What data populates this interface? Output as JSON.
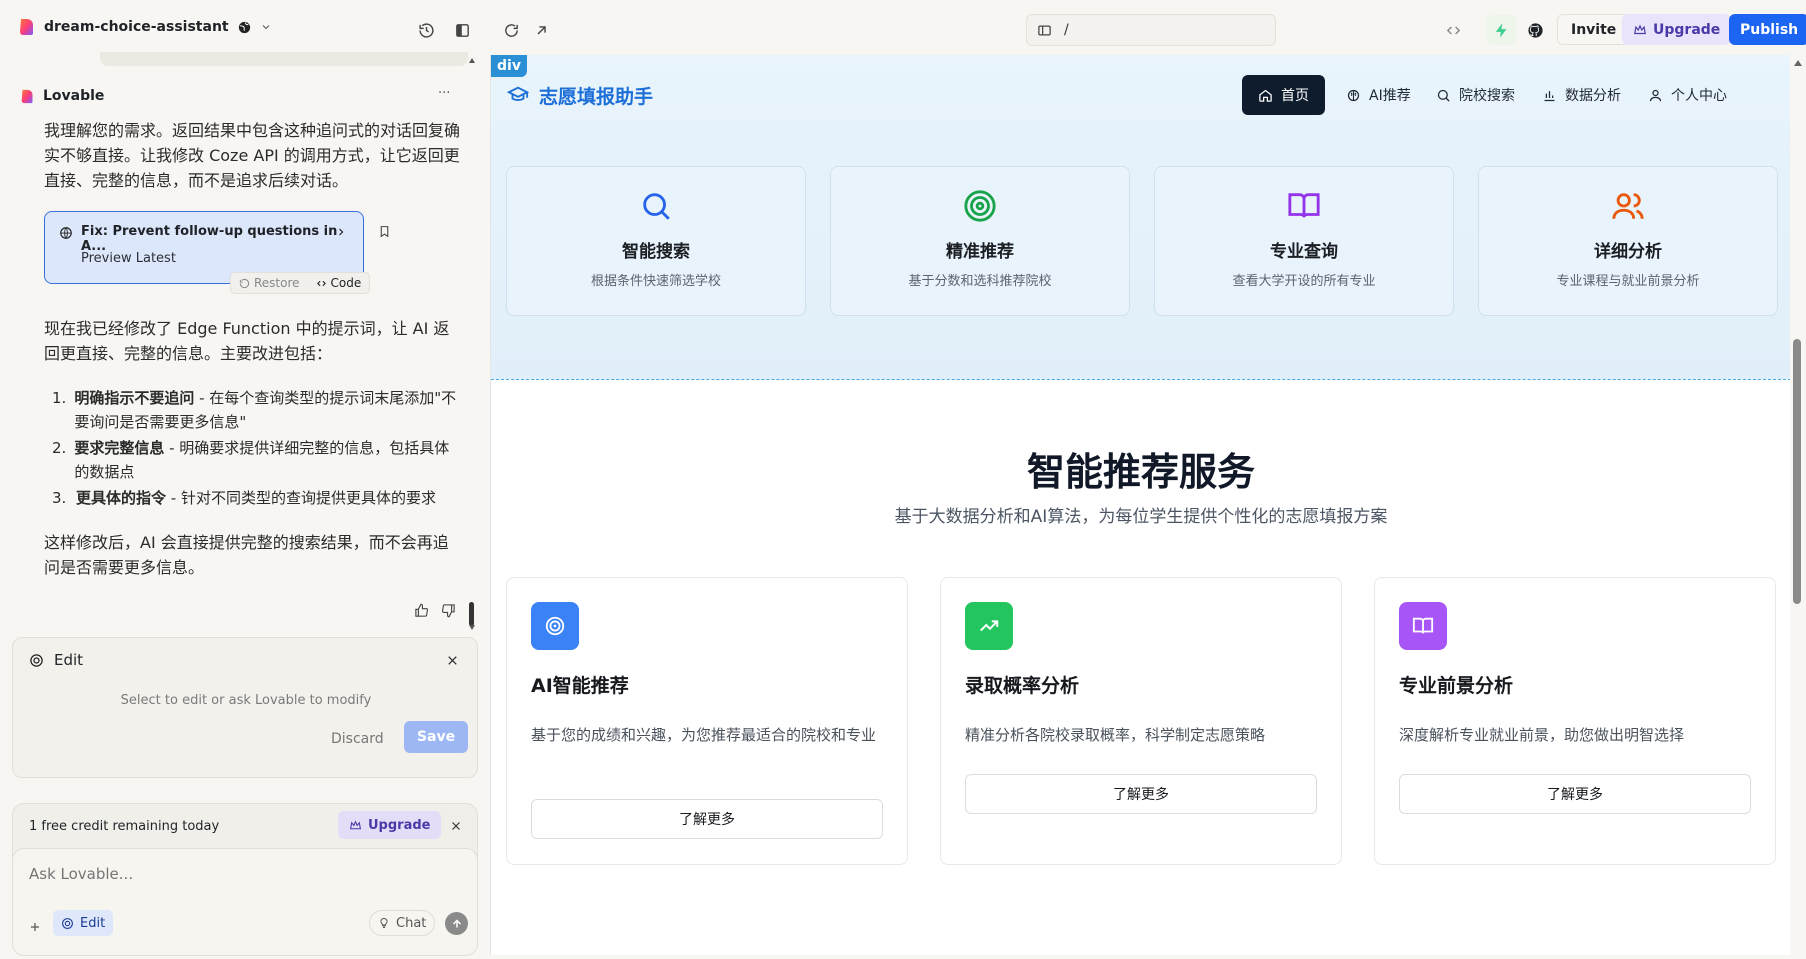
{
  "project": {
    "name": "dream-choice-assistant"
  },
  "topbar": {
    "url_path": "/",
    "invite_label": "Invite",
    "upgrade_label": "Upgrade",
    "publish_label": "Publish"
  },
  "chat": {
    "sender": "Lovable",
    "menu_label": "···",
    "message1": "我理解您的需求。返回结果中包含这种追问式的对话回复确实不够直接。让我修改 Coze API 的调用方式，让它返回更直接、完整的信息，而不是追求后续对话。",
    "commit": {
      "title": "Fix: Prevent follow-up questions in A...",
      "subtitle": "Preview Latest",
      "restore_label": "Restore",
      "code_label": "Code"
    },
    "message2": "现在我已经修改了 Edge Function 中的提示词，让 AI 返回更直接、完整的信息。主要改进包括：",
    "list": [
      {
        "num": "1.",
        "bold": "明确指示不要追问",
        "rest": " - 在每个查询类型的提示词末尾添加\"不要询问是否需要更多信息\""
      },
      {
        "num": "2.",
        "bold": "要求完整信息",
        "rest": " - 明确要求提供详细完整的信息，包括具体的数据点"
      },
      {
        "num": "3.",
        "bold": "更具体的指令",
        "rest": " - 针对不同类型的查询提供更具体的要求"
      }
    ],
    "message3": "这样修改后，AI 会直接提供完整的搜索结果，而不会再追问是否需要更多信息。"
  },
  "edit_panel": {
    "title": "Edit",
    "hint": "Select to edit or ask Lovable to modify",
    "discard_label": "Discard",
    "save_label": "Save"
  },
  "credit": {
    "text": "1 free credit remaining today",
    "upgrade_label": "Upgrade"
  },
  "composer": {
    "placeholder": "Ask Lovable...",
    "edit_label": "Edit",
    "chat_label": "Chat"
  },
  "preview": {
    "badge": "div",
    "brand": "志愿填报助手",
    "nav": [
      {
        "label": "首页",
        "icon": "home-icon"
      },
      {
        "label": "AI推荐",
        "icon": "brain-icon"
      },
      {
        "label": "院校搜索",
        "icon": "search-icon"
      },
      {
        "label": "数据分析",
        "icon": "bar-chart-icon"
      },
      {
        "label": "个人中心",
        "icon": "user-icon"
      }
    ],
    "features": [
      {
        "title": "智能搜索",
        "desc": "根据条件快速筛选学校",
        "icon": "search-icon",
        "color": "#2563eb"
      },
      {
        "title": "精准推荐",
        "desc": "基于分数和选科推荐院校",
        "icon": "target-icon",
        "color": "#16a34a"
      },
      {
        "title": "专业查询",
        "desc": "查看大学开设的所有专业",
        "icon": "book-icon",
        "color": "#9333ea"
      },
      {
        "title": "详细分析",
        "desc": "专业课程与就业前景分析",
        "icon": "users-icon",
        "color": "#ea580c"
      }
    ],
    "section_title": "智能推荐服务",
    "section_subtitle": "基于大数据分析和AI算法，为每位学生提供个性化的志愿填报方案",
    "services": [
      {
        "title": "AI智能推荐",
        "desc": "基于您的成绩和兴趣，为您推荐最适合的院校和专业",
        "button": "了解更多",
        "icon": "target-icon",
        "color": "#3b82f6"
      },
      {
        "title": "录取概率分析",
        "desc": "精准分析各院校录取概率，科学制定志愿策略",
        "button": "了解更多",
        "icon": "trending-up-icon",
        "color": "#22c55e"
      },
      {
        "title": "专业前景分析",
        "desc": "深度解析专业就业前景，助您做出明智选择",
        "button": "了解更多",
        "icon": "book-icon",
        "color": "#a855f7"
      }
    ]
  }
}
